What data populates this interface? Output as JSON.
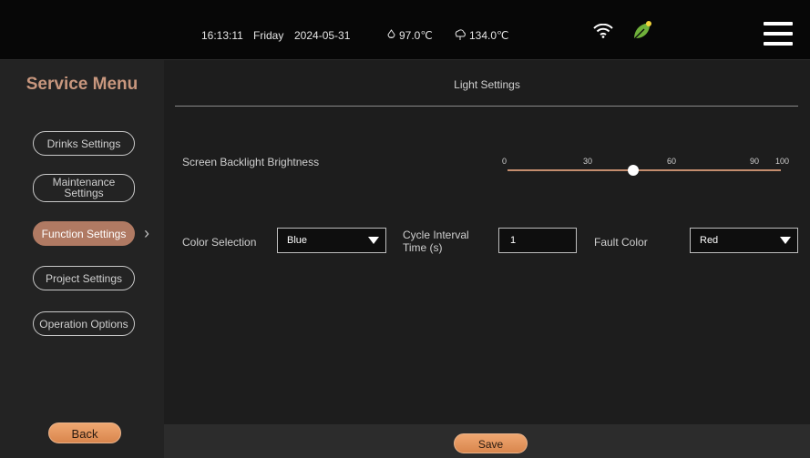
{
  "status": {
    "time": "16:13:11",
    "day": "Friday",
    "date": "2024-05-31",
    "temp1": "97.0℃",
    "temp2": "134.0℃"
  },
  "sidebar": {
    "title": "Service Menu",
    "items": [
      {
        "label": "Drinks Settings"
      },
      {
        "label": "Maintenance Settings"
      },
      {
        "label": "Function Settings",
        "active": true
      },
      {
        "label": "Project Settings"
      },
      {
        "label": "Operation Options"
      }
    ],
    "back_label": "Back"
  },
  "main": {
    "title": "Light Settings",
    "backlight": {
      "label": "Screen Backlight Brightness",
      "ticks": [
        "0",
        "30",
        "60",
        "90",
        "100"
      ],
      "value_percent": 46
    },
    "color_selection": {
      "label": "Color Selection",
      "value": "Blue"
    },
    "cycle_interval": {
      "label": "Cycle Interval Time (s)",
      "value": "1"
    },
    "fault_color": {
      "label": "Fault Color",
      "value": "Red"
    },
    "save_label": "Save"
  },
  "colors": {
    "accent": "#b07a63",
    "button": "#e9995f",
    "title": "#c8977e",
    "leaf": "#6fb03a"
  }
}
